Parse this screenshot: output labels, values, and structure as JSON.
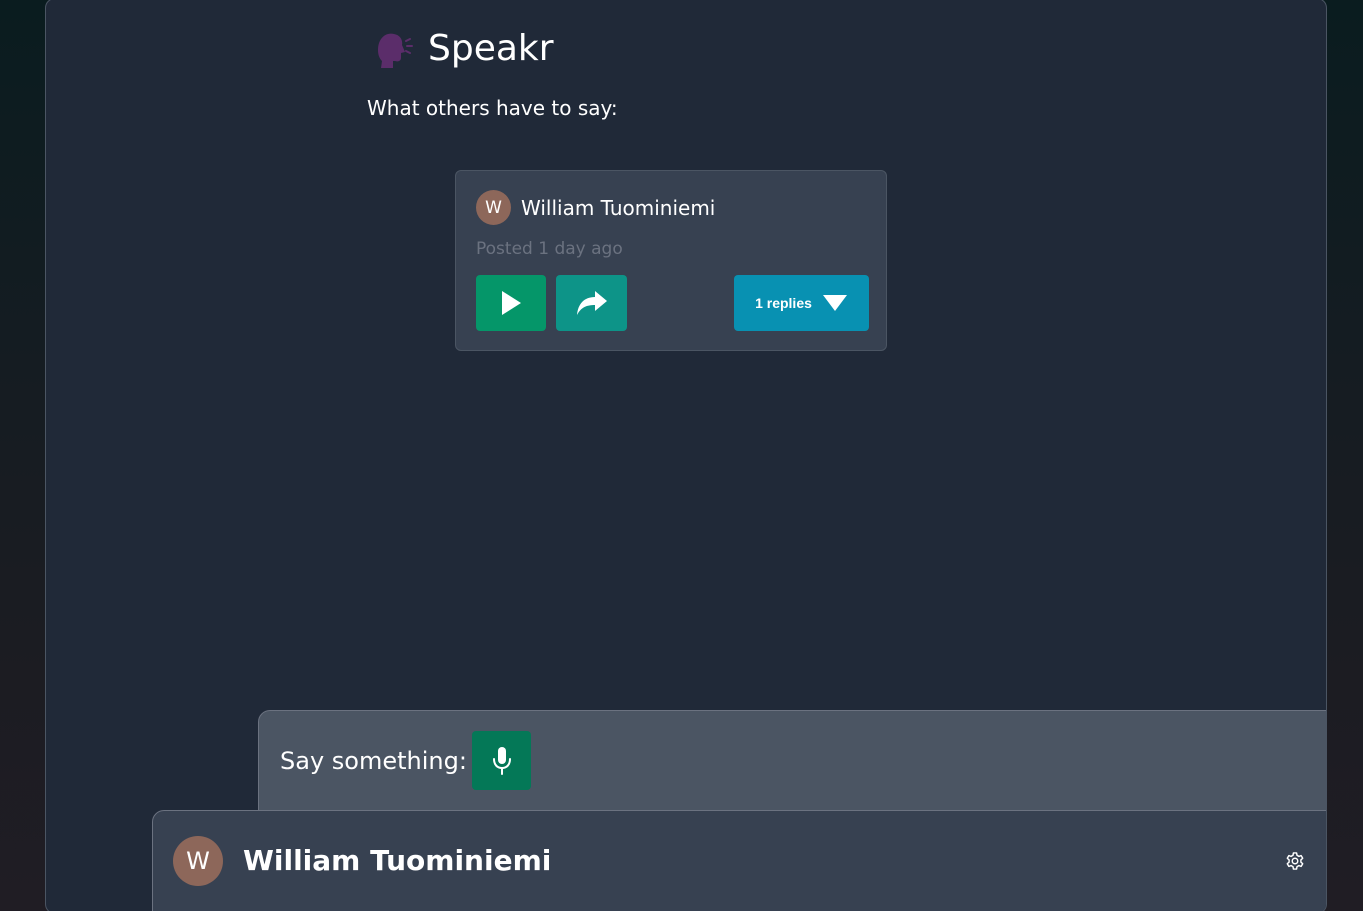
{
  "app": {
    "title": "Speakr",
    "logo_icon": "speaking-head-icon",
    "subtitle": "What others have to say:"
  },
  "feed": {
    "posts": [
      {
        "author": "William Tuominiemi",
        "avatar_initial": "W",
        "posted": "Posted 1 day ago",
        "replies_label": "1 replies",
        "play_icon": "play-icon",
        "share_icon": "share-icon",
        "replies_icon": "caret-down-icon"
      }
    ]
  },
  "composer": {
    "label": "Say something:",
    "mic_icon": "microphone-icon"
  },
  "user": {
    "name": "William Tuominiemi",
    "avatar_initial": "W",
    "settings_icon": "gear-icon"
  },
  "colors": {
    "page_bg": "#202938",
    "card_bg": "#374151",
    "composer_bg": "#4b5563",
    "play_green": "#059669",
    "share_teal": "#0d9488",
    "replies_cyan": "#0891b2",
    "mic_green": "#047857",
    "avatar_brown": "#8d675a",
    "muted_text": "#6b7280"
  }
}
